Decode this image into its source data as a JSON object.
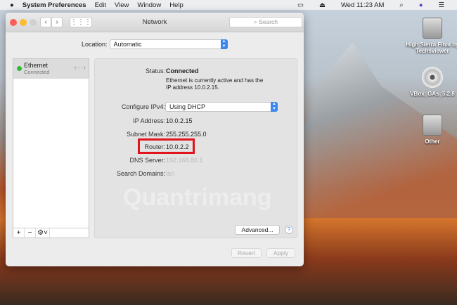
{
  "menubar": {
    "apple": "",
    "app": "System Preferences",
    "items": [
      "Edit",
      "View",
      "Window",
      "Help"
    ],
    "clock": "Wed 11:23 AM"
  },
  "window": {
    "title": "Network",
    "search_placeholder": "Search",
    "location_label": "Location:",
    "location_value": "Automatic"
  },
  "sidebar": {
    "items": [
      {
        "name": "Ethernet",
        "status": "Connected",
        "status_color": "#2ebd3b"
      }
    ],
    "add": "+",
    "remove": "−",
    "gear": "⚙"
  },
  "details": {
    "status_label": "Status:",
    "status_value": "Connected",
    "status_desc": "Ethernet is currently active and has the IP address 10.0.2.15.",
    "configure_label": "Configure IPv4:",
    "configure_value": "Using DHCP",
    "ip_label": "IP Address:",
    "ip_value": "10.0.2.15",
    "subnet_label": "Subnet Mask:",
    "subnet_value": "255.255.255.0",
    "router_label": "Router:",
    "router_value": "10.0.2.2",
    "dns_label": "DNS Server:",
    "dns_value": "192.168.86.1",
    "domains_label": "Search Domains:",
    "domains_value": "lan",
    "advanced": "Advanced...",
    "help": "?"
  },
  "footer": {
    "revert": "Revert",
    "apply": "Apply"
  },
  "desktop": {
    "icons": [
      "High Sierra Final by Techsviewer",
      "VBox_GAs_5.2.8",
      "Other"
    ]
  },
  "watermark": "Quantrimang",
  "highlight_color": "#e0141a"
}
